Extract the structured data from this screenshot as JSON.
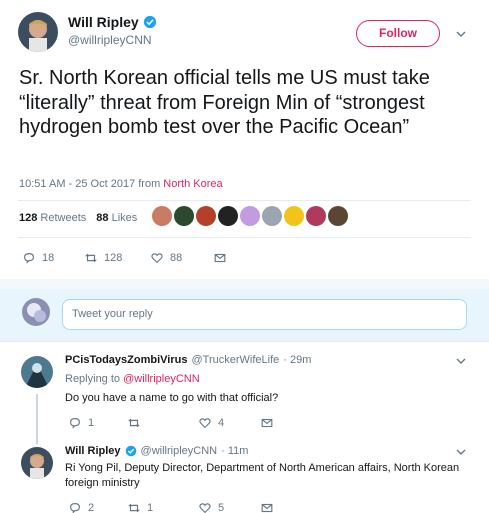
{
  "tweet": {
    "author": {
      "name": "Will Ripley",
      "handle": "@willripleyCNN",
      "verified": true
    },
    "follow_label": "Follow",
    "text": "Sr. North Korean official tells me US must take “literally” threat from Foreign Min of “strongest hydrogen bomb test over the Pacific Ocean”",
    "timestamp": "10:51 AM - 25 Oct 2017 from ",
    "location": "North Korea",
    "retweets_count": "128",
    "retweets_label": "Retweets",
    "likes_count": "88",
    "likes_label": "Likes",
    "actions": {
      "replies": "18",
      "retweets": "128",
      "likes": "88"
    }
  },
  "reply_box": {
    "placeholder": "Tweet your reply"
  },
  "replies": [
    {
      "name": "PCisTodaysZombiVirus",
      "handle": "@TruckerWifeLife",
      "time": "· 29m",
      "replying_prefix": "Replying to ",
      "replying_to": "@willripleyCNN",
      "text": "Do you have a name to go with that official?",
      "actions": {
        "replies": "1",
        "retweets": "",
        "likes": "4"
      }
    },
    {
      "name": "Will Ripley",
      "handle": "@willripleyCNN",
      "time": "· 11m",
      "text": "Ri Yong Pil, Deputy Director, Department of North American affairs, North Korean foreign ministry",
      "actions": {
        "replies": "2",
        "retweets": "1",
        "likes": "5"
      }
    }
  ],
  "colors": {
    "accent": "#e0245e",
    "secondary_text": "#657786",
    "verified": "#1da1f2",
    "reply_bar": "#e8f5fd"
  }
}
